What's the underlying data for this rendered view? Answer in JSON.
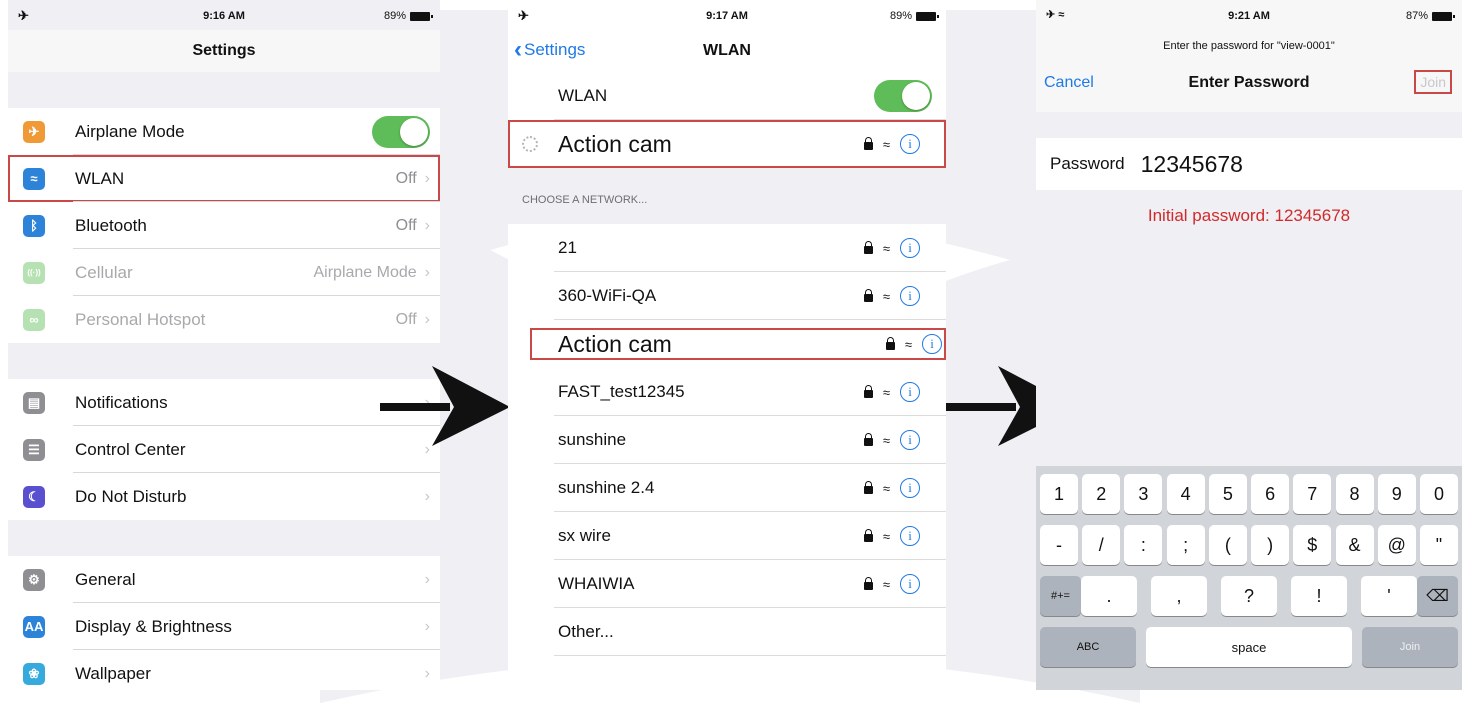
{
  "screen1": {
    "status": {
      "left_icon": "airplane-icon",
      "time": "9:16 AM",
      "battery": "89%"
    },
    "title": "Settings",
    "groups": [
      [
        {
          "label": "Airplane Mode",
          "icon": "airplane-icon",
          "color": "#f09a37",
          "control": "toggle-on"
        },
        {
          "label": "WLAN",
          "icon": "wifi-icon",
          "color": "#2d83d8",
          "value": "Off",
          "highlighted": true
        },
        {
          "label": "Bluetooth",
          "icon": "bluetooth-icon",
          "color": "#2d83d8",
          "value": "Off"
        },
        {
          "label": "Cellular",
          "icon": "cellular-icon",
          "color": "#5fbf58",
          "value": "Airplane Mode",
          "disabled": true
        },
        {
          "label": "Personal Hotspot",
          "icon": "hotspot-icon",
          "color": "#5fbf58",
          "value": "Off",
          "disabled": true
        }
      ],
      [
        {
          "label": "Notifications",
          "icon": "notifications-icon",
          "color": "#8e8e93"
        },
        {
          "label": "Control Center",
          "icon": "control-center-icon",
          "color": "#8e8e93"
        },
        {
          "label": "Do Not Disturb",
          "icon": "moon-icon",
          "color": "#5a4fcf"
        }
      ],
      [
        {
          "label": "General",
          "icon": "gear-icon",
          "color": "#8e8e93"
        },
        {
          "label": "Display & Brightness",
          "icon": "display-icon",
          "color": "#2d83d8"
        },
        {
          "label": "Wallpaper",
          "icon": "wallpaper-icon",
          "color": "#36aadc"
        }
      ]
    ]
  },
  "screen2": {
    "status": {
      "left_icon": "airplane-icon",
      "time": "9:17 AM",
      "battery": "89%"
    },
    "back_label": "Settings",
    "title": "WLAN",
    "wlan_label": "WLAN",
    "connecting_network": "Action cam",
    "section_header": "CHOOSE A NETWORK...",
    "networks": [
      "21",
      "360-WiFi-QA",
      "Action cam",
      "FAST_test12345",
      "sunshine",
      "sunshine 2.4",
      "sx wire",
      "WHAIWIA"
    ],
    "highlighted_network": "Action cam",
    "other_label": "Other..."
  },
  "screen3": {
    "status": {
      "left_icon": "airplane-wifi-icon",
      "time": "9:21 AM",
      "battery": "87%"
    },
    "prompt": "Enter the password for \"view-0001\"",
    "cancel_label": "Cancel",
    "title": "Enter Password",
    "join_label": "Join",
    "password_label": "Password",
    "password_value": "12345678",
    "note": "Initial password: 12345678",
    "keyboard": {
      "row1": [
        "1",
        "2",
        "3",
        "4",
        "5",
        "6",
        "7",
        "8",
        "9",
        "0"
      ],
      "row2": [
        "-",
        "/",
        ":",
        ";",
        "(",
        ")",
        "$",
        "&",
        "@",
        "\""
      ],
      "row3_left": "#+=",
      "row3": [
        ".",
        ",",
        "?",
        "!",
        "'"
      ],
      "row4": {
        "abc": "ABC",
        "space": "space",
        "join": "Join"
      }
    }
  },
  "colors": {
    "ios_blue": "#1f7ae6",
    "toggle_green": "#5ebd58",
    "highlight_red": "#c94848",
    "note_red": "#d12a2a"
  }
}
